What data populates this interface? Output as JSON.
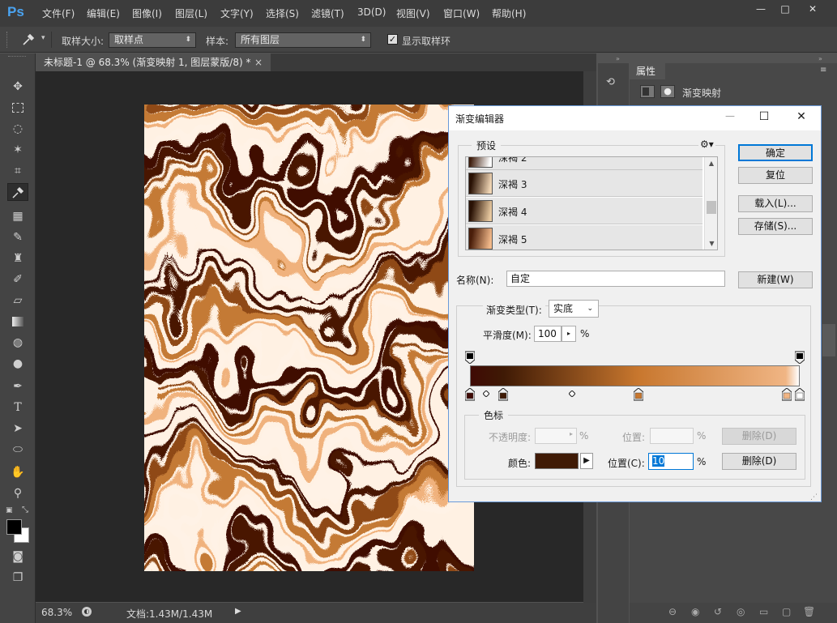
{
  "app": {
    "logo": "Ps",
    "menu": [
      "文件(F)",
      "编辑(E)",
      "图像(I)",
      "图层(L)",
      "文字(Y)",
      "选择(S)",
      "滤镜(T)",
      "3D(D)",
      "视图(V)",
      "窗口(W)",
      "帮助(H)"
    ],
    "window_controls": {
      "minimize": "—",
      "maximize": "□",
      "close": "✕"
    }
  },
  "options_bar": {
    "sample_size_label": "取样大小:",
    "sample_size_value": "取样点",
    "sample_label": "样本:",
    "sample_value": "所有图层",
    "show_ring_label": "显示取样环",
    "show_ring_checked": true
  },
  "document": {
    "tab_title": "未标题-1 @ 68.3% (渐变映射 1, 图层蒙版/8) *",
    "tab_close": "×",
    "zoom": "68.3%",
    "doc_info": "文档:1.43M/1.43M"
  },
  "properties_panel": {
    "tab": "属性",
    "adjustment_label": "渐变映射"
  },
  "colors": {
    "foreground": "#000000",
    "background": "#ffffff",
    "accent": "#0078d7",
    "gradient": [
      "#3f0a05",
      "#4a1506",
      "#8f4a18",
      "#c47a35",
      "#f0b27d",
      "#fff2e6"
    ]
  },
  "gradient_editor": {
    "title": "渐变编辑器",
    "controls": {
      "minimize": "—",
      "maximize": "☐",
      "close": "✕"
    },
    "presets_label": "预设",
    "presets": [
      {
        "name": "深褐 2",
        "colors": [
          "#3f1e0e",
          "#ffffff"
        ]
      },
      {
        "name": "深褐 3",
        "colors": [
          "#2a1205",
          "#f0d5b4"
        ]
      },
      {
        "name": "深褐 4",
        "colors": [
          "#2a1205",
          "#e8c9a0"
        ]
      },
      {
        "name": "深褐 5",
        "colors": [
          "#4a1e0a",
          "#f2b98a"
        ]
      }
    ],
    "buttons": {
      "ok": "确定",
      "reset": "复位",
      "load": "载入(L)...",
      "save": "存储(S)...",
      "new": "新建(W)"
    },
    "name_label": "名称(N):",
    "name_value": "自定",
    "gradient_type_label": "渐变类型(T):",
    "gradient_type_value": "实底",
    "smoothness_label": "平滑度(M):",
    "smoothness_value": "100",
    "percent": "%",
    "stops_group_label": "色标",
    "opacity_label": "不透明度:",
    "opacity_position_label": "位置:",
    "delete_label": "删除(D)",
    "color_label": "颜色:",
    "color_value": "#3f1a05",
    "color_position_label": "位置(C):",
    "color_position_value": "10",
    "color_stops": [
      {
        "position": 0,
        "color": "#3f0a05"
      },
      {
        "position": 10,
        "color": "#3f1a05"
      },
      {
        "position": 51,
        "color": "#c8772e"
      },
      {
        "position": 96,
        "color": "#f0b584"
      },
      {
        "position": 100,
        "color": "#ffffff"
      }
    ],
    "midpoints": [
      5,
      31
    ],
    "opacity_stops": [
      0,
      100
    ]
  }
}
